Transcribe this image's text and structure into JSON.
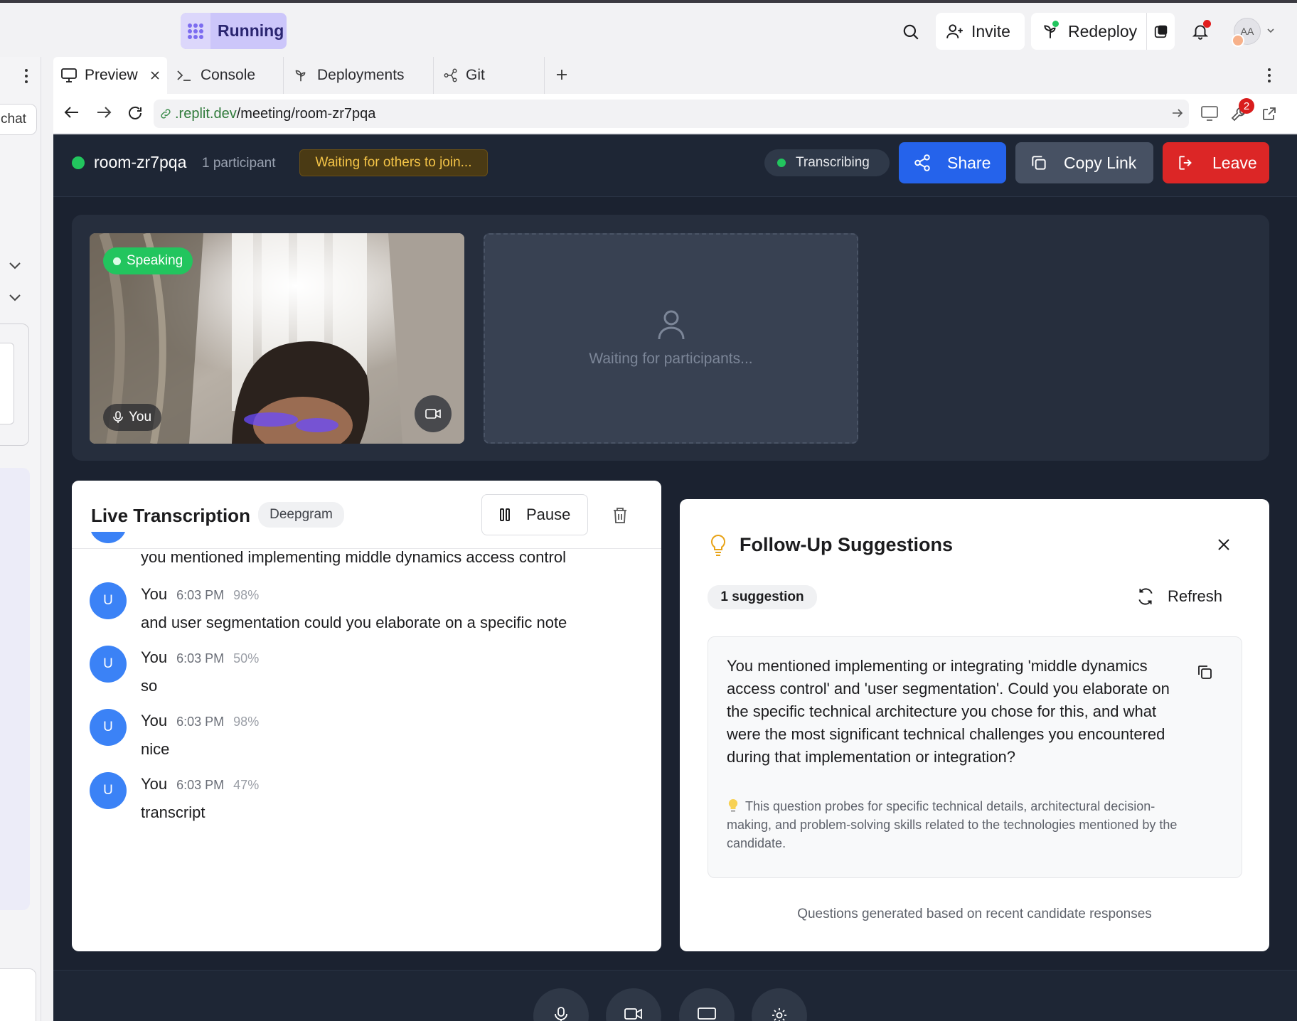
{
  "ide": {
    "status_label": "Running",
    "invite_label": "Invite",
    "redeploy_label": "Redeploy",
    "avatar_initials": "AA",
    "left_chat_label": "chat",
    "tabs": [
      {
        "label": "Preview"
      },
      {
        "label": "Console"
      },
      {
        "label": "Deployments"
      },
      {
        "label": "Git"
      }
    ],
    "url_host": ".replit.dev",
    "url_path": "/meeting/room-zr7pqa",
    "notification_count": "2"
  },
  "meeting": {
    "room_name": "room-zr7pqa",
    "participants": "1 participant",
    "waiting_banner": "Waiting for others to join...",
    "transcribing_label": "Transcribing",
    "share_label": "Share",
    "copy_link_label": "Copy Link",
    "leave_label": "Leave",
    "speaking_badge": "Speaking",
    "self_label": "You",
    "placeholder_text": "Waiting for participants..."
  },
  "transcription": {
    "title": "Live Transcription",
    "provider": "Deepgram",
    "pause_label": "Pause",
    "partial_text": "you mentioned implementing middle dynamics access control",
    "messages": [
      {
        "initial": "U",
        "name": "You",
        "time": "6:03 PM",
        "confidence": "98%",
        "text": "and user segmentation could you elaborate on a specific note"
      },
      {
        "initial": "U",
        "name": "You",
        "time": "6:03 PM",
        "confidence": "50%",
        "text": "so"
      },
      {
        "initial": "U",
        "name": "You",
        "time": "6:03 PM",
        "confidence": "98%",
        "text": "nice"
      },
      {
        "initial": "U",
        "name": "You",
        "time": "6:03 PM",
        "confidence": "47%",
        "text": "transcript"
      }
    ]
  },
  "suggestions": {
    "title": "Follow-Up Suggestions",
    "count_label": "1 suggestion",
    "refresh_label": "Refresh",
    "items": [
      {
        "question": "You mentioned implementing or integrating 'middle dynamics access control' and 'user segmentation'. Could you elaborate on the specific technical architecture you chose for this, and what were the most significant technical challenges you encountered during that implementation or integration?",
        "rationale": "This question probes for specific technical details, architectural decision-making, and problem-solving skills related to the technologies mentioned by the candidate."
      }
    ],
    "footer": "Questions generated based on recent candidate responses"
  },
  "colors": {
    "accent_blue": "#2563eb",
    "leave_red": "#dc2626",
    "status_green": "#22c55e",
    "warning_amber": "#f4c447"
  }
}
